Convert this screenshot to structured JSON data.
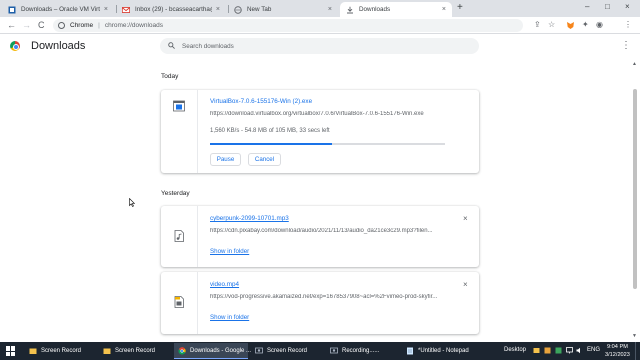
{
  "tabs": [
    {
      "title": "Downloads – Oracle VM VirtualBox",
      "close": "×"
    },
    {
      "title": "Inbox (29) - bcasseacartha@gmail",
      "close": "×"
    },
    {
      "title": "New Tab",
      "close": "×"
    },
    {
      "title": "Downloads",
      "close": "×"
    }
  ],
  "new_tab": "+",
  "window_controls": {
    "minimize": "–",
    "maximize": "□",
    "close": "×"
  },
  "toolbar": {
    "back": "←",
    "forward": "→",
    "reload": "C",
    "chip": "Chrome",
    "url": "chrome://downloads",
    "share": "⇪",
    "star": "☆",
    "extensions": "✦",
    "profile": "◉",
    "menu": "⋮"
  },
  "page": {
    "title": "Downloads",
    "search_placeholder": "Search downloads",
    "menu": "⋮"
  },
  "sections": {
    "today": "Today",
    "yesterday": "Yesterday"
  },
  "downloads": [
    {
      "name": "VirtualBox-7.0.6-155176-Win (2).exe",
      "url": "https://download.virtualbox.org/virtualbox/7.0.6/VirtualBox-7.0.6-155176-Win.exe",
      "status": "1,560 KB/s - 54.8 MB of 105 MB, 33 secs left",
      "progress": 0.52,
      "pause": "Pause",
      "cancel": "Cancel"
    },
    {
      "name": "cyberpunk-2099-10701.mp3",
      "url": "https://cdn.pixabay.com/download/audio/2021/11/13/audio_da21ce3c29.mp3?filen...",
      "link": "Show in folder",
      "close": "×"
    },
    {
      "name": "video.mp4",
      "url": "https://vod-progressive.akamaized.net/exp=1678537908~acl=%2Fvimeo-prod-skyfir...",
      "link": "Show in folder",
      "close": "×"
    }
  ],
  "taskbar": {
    "items": [
      {
        "label": "Screen Record",
        "active": false
      },
      {
        "label": "Screen Record",
        "active": false
      },
      {
        "label": "Downloads - Google ...",
        "active": true
      },
      {
        "label": "Screen Record",
        "active": false
      },
      {
        "label": "Recording......",
        "active": false
      },
      {
        "label": "*Untitled - Notepad",
        "active": false
      }
    ],
    "desktop": "Desktop",
    "lang": "ENG",
    "time": "9:04 PM",
    "date": "3/12/2023"
  },
  "colors": {
    "accent": "#1a73e8",
    "tabstrip": "#dee1e6",
    "taskbar": "#1c2530"
  }
}
